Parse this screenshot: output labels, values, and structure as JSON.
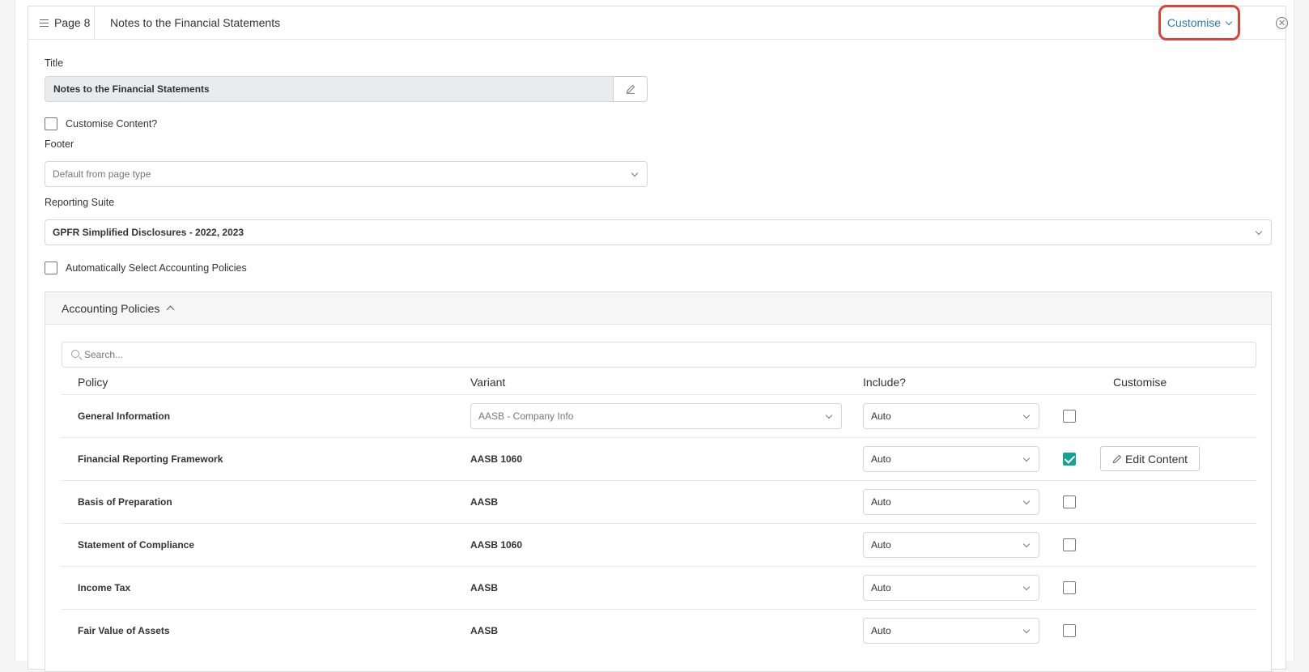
{
  "header": {
    "page_label": "Page 8",
    "title": "Notes to the Financial Statements",
    "customise_label": "Customise"
  },
  "form": {
    "title_label": "Title",
    "title_value": "Notes to the Financial Statements",
    "customise_content_label": "Customise Content?",
    "footer_label": "Footer",
    "footer_value": "Default from page type",
    "reporting_suite_label": "Reporting Suite",
    "reporting_suite_value": "GPFR Simplified Disclosures - 2022, 2023",
    "auto_select_label": "Automatically Select Accounting Policies"
  },
  "policies": {
    "section_title": "Accounting Policies",
    "search_placeholder": "Search...",
    "columns": [
      "Policy",
      "Variant",
      "Include?",
      "Customise"
    ],
    "edit_content_label": "Edit Content",
    "rows": [
      {
        "policy": "General Information",
        "variant": "AASB - Company Info",
        "include": "Auto",
        "customised": false
      },
      {
        "policy": "Financial Reporting Framework",
        "variant": "AASB 1060",
        "include": "Auto",
        "customised": true
      },
      {
        "policy": "Basis of Preparation",
        "variant": "AASB",
        "include": "Auto",
        "customised": false
      },
      {
        "policy": "Statement of Compliance",
        "variant": "AASB 1060",
        "include": "Auto",
        "customised": false
      },
      {
        "policy": "Income Tax",
        "variant": "AASB",
        "include": "Auto",
        "customised": false
      },
      {
        "policy": "Fair Value of Assets",
        "variant": "AASB",
        "include": "Auto",
        "customised": false
      }
    ]
  },
  "colors": {
    "accent_link": "#2a7bbd",
    "highlight_border": "#d9443a",
    "checkbox_checked": "#12a394"
  }
}
